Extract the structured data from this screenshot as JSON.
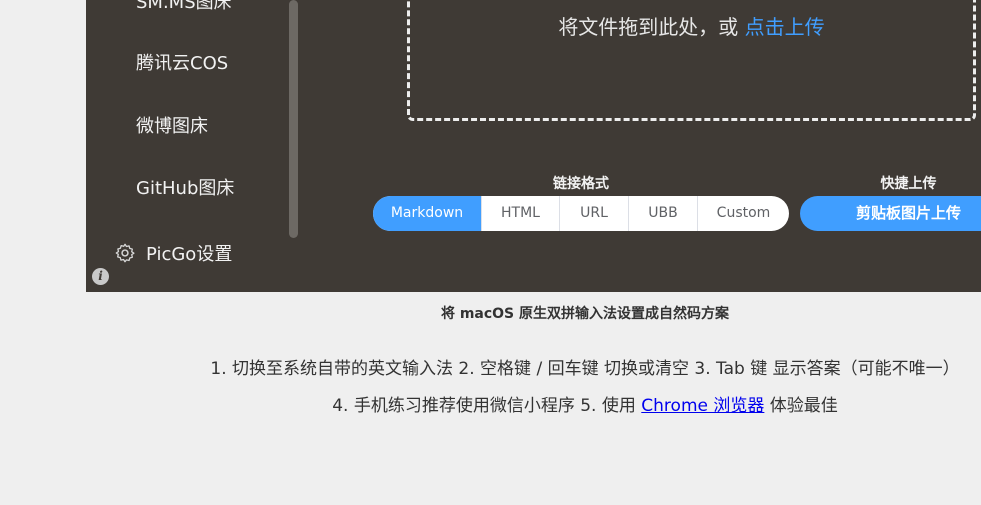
{
  "sidebar": {
    "items": [
      {
        "label": "SM.MS图床"
      },
      {
        "label": "腾讯云COS"
      },
      {
        "label": "微博图床"
      },
      {
        "label": "GitHub图床"
      }
    ],
    "settings_label": "PicGo设置",
    "settings_icon": "gear-icon",
    "info_icon": "info-icon"
  },
  "upload": {
    "drop_text": "将文件拖到此处，或 ",
    "drop_link": "点击上传"
  },
  "link_format": {
    "title": "链接格式",
    "options": [
      "Markdown",
      "HTML",
      "URL",
      "UBB",
      "Custom"
    ],
    "selected": "Markdown"
  },
  "quick_upload": {
    "title": "快捷上传",
    "button_label": "剪贴板图片上传"
  },
  "page": {
    "caption": "将 macOS 原生双拼输入法设置成自然码方案",
    "tips_line1": "1. 切换至系统自带的英文输入法 2. 空格键 / 回车键 切换或清空 3. Tab 键 显示答案（可能不唯一）",
    "tips_line2_before": "4. 手机练习推荐使用微信小程序 5. 使用 ",
    "tips_line2_link": "Chrome 浏览器",
    "tips_line2_after": " 体验最佳"
  },
  "colors": {
    "accent": "#409eff",
    "app_bg": "#3f3a35",
    "page_bg": "#efefef",
    "link": "#0000ee"
  }
}
